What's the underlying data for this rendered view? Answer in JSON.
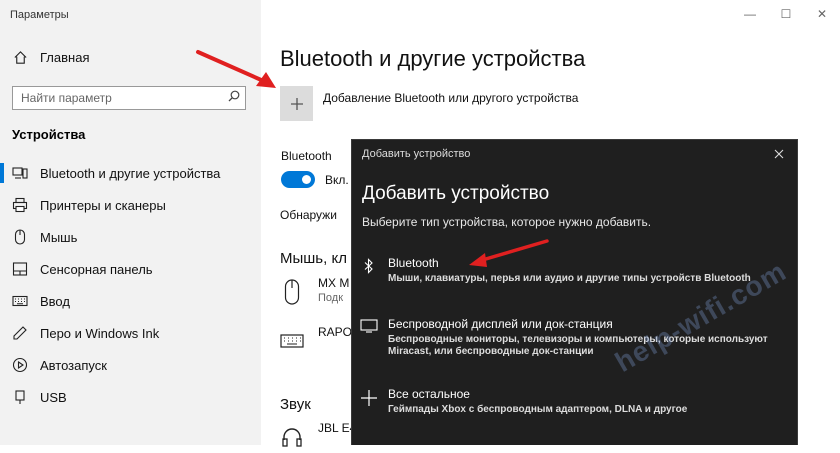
{
  "window": {
    "title": "Параметры",
    "controls": [
      "—",
      "☐",
      "✕"
    ]
  },
  "sidebar": {
    "home_label": "Главная",
    "search_placeholder": "Найти параметр",
    "section_title": "Устройства",
    "items": [
      {
        "label": "Bluetooth и другие устройства",
        "icon": "devices-icon",
        "active": true
      },
      {
        "label": "Принтеры и сканеры",
        "icon": "printer-icon"
      },
      {
        "label": "Мышь",
        "icon": "mouse-icon"
      },
      {
        "label": "Сенсорная панель",
        "icon": "touchpad-icon"
      },
      {
        "label": "Ввод",
        "icon": "keyboard-icon"
      },
      {
        "label": "Перо и Windows Ink",
        "icon": "pen-icon"
      },
      {
        "label": "Автозапуск",
        "icon": "autoplay-icon"
      },
      {
        "label": "USB",
        "icon": "usb-icon"
      }
    ]
  },
  "main": {
    "title": "Bluetooth и другие устройства",
    "add_device_label": "Добавление Bluetooth или другого устройства",
    "bluetooth_label": "Bluetooth",
    "toggle_text": "Вкл.",
    "discover_text": "Обнаружи",
    "mouse_section": "Мышь, кл",
    "devices": [
      {
        "name": "MX M",
        "status": "Подк",
        "icon": "mouse-icon"
      },
      {
        "name": "RAPO",
        "status": "",
        "icon": "keyboard-icon"
      }
    ],
    "sound_section": "Звук",
    "sound_device": "JBL E4"
  },
  "dialog": {
    "title": "Добавить устройство",
    "heading": "Добавить устройство",
    "subtitle": "Выберите тип устройства, которое нужно добавить.",
    "options": [
      {
        "icon": "bluetooth-icon",
        "name": "Bluetooth",
        "desc": "Мыши, клавиатуры, перья или аудио и другие типы устройств Bluetooth"
      },
      {
        "icon": "monitor-icon",
        "name": "Беспроводной дисплей или док-станция",
        "desc": "Беспроводные мониторы, телевизоры и компьютеры, которые используют Miracast, или беспроводные док-станции"
      },
      {
        "icon": "plus-icon",
        "name": "Все остальное",
        "desc": "Геймпады Xbox с беспроводным адаптером, DLNA и другое"
      }
    ]
  },
  "watermark": "help-wifi.com",
  "colors": {
    "accent": "#0078d7",
    "annotation_arrow": "#e02020",
    "dialog_bg": "#1f1f1f"
  }
}
